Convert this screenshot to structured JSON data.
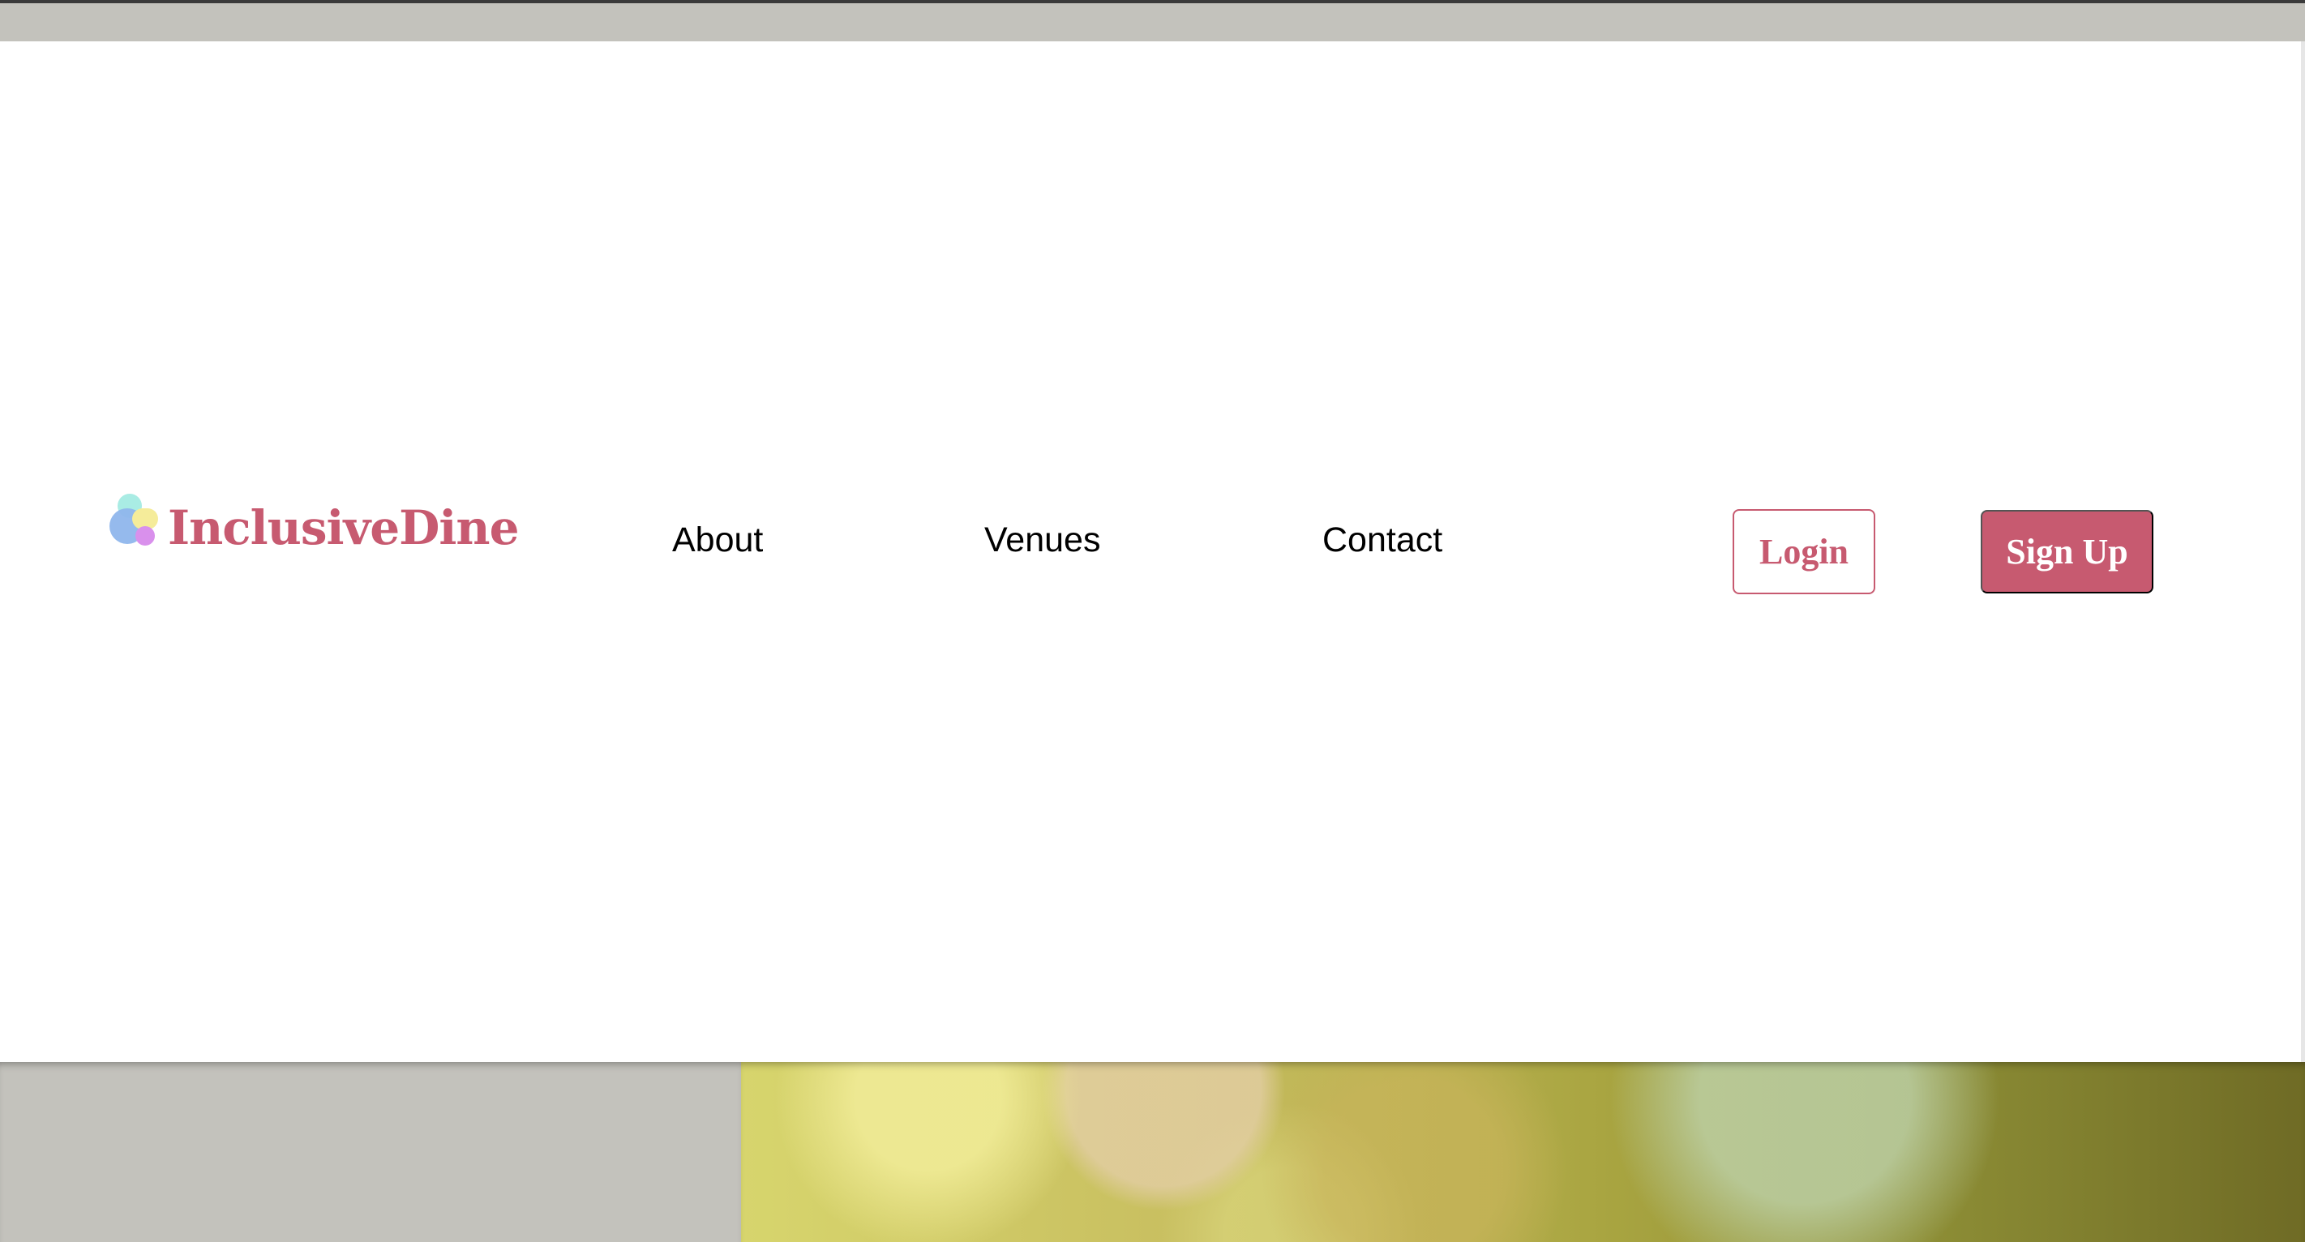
{
  "brand": {
    "name": "InclusiveDine",
    "logo_icon": "overlapping-circles-logo-icon",
    "color": "#c75a70"
  },
  "nav": {
    "links": [
      {
        "label": "About"
      },
      {
        "label": "Venues"
      },
      {
        "label": "Contact"
      }
    ]
  },
  "auth": {
    "login_label": "Login",
    "signup_label": "Sign Up"
  },
  "colors": {
    "accent": "#c75a70",
    "top_bar": "#c3c2bc"
  }
}
